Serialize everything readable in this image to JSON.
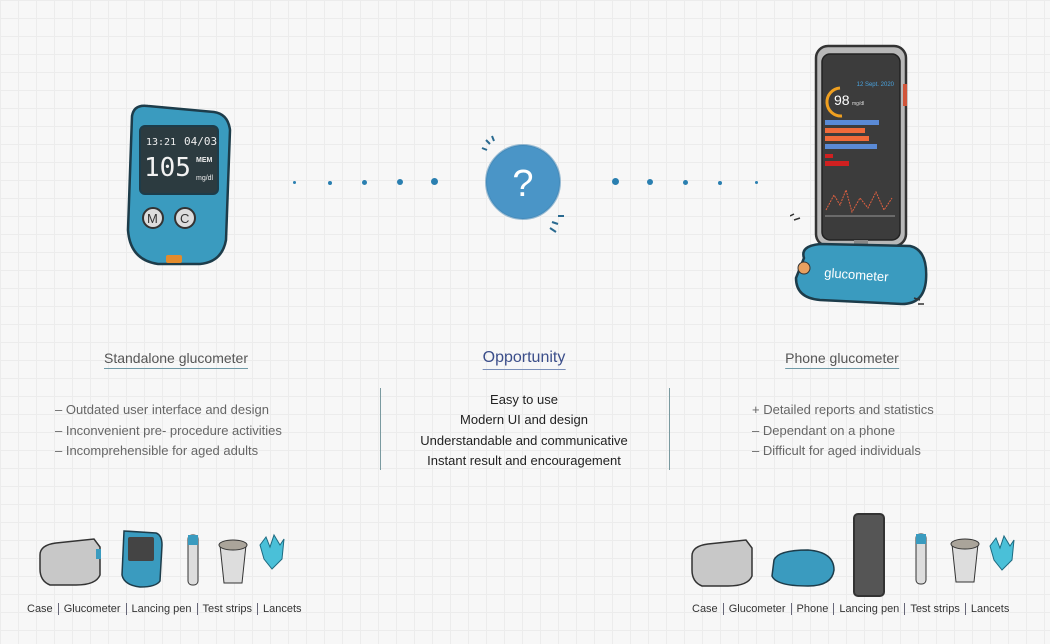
{
  "standalone": {
    "heading": "Standalone glucometer",
    "points": [
      "– Outdated user interface and design",
      "– Inconvenient pre- procedure activities",
      "– Incomprehensible for aged adults"
    ],
    "device_screen": {
      "time": "13:21",
      "date": "04/03",
      "reading": "105",
      "mem": "MEM",
      "unit": "mg/dl",
      "buttons": [
        "M",
        "C"
      ]
    },
    "kit_labels": [
      "Case",
      "Glucometer",
      "Lancing pen",
      "Test strips",
      "Lancets"
    ]
  },
  "opportunity": {
    "heading": "Opportunity",
    "icon": "question-mark-icon",
    "points": [
      "Easy to use",
      "Modern UI and design",
      "Understandable and communicative",
      "Instant result and encouragement"
    ]
  },
  "phone": {
    "heading": "Phone glucometer",
    "points": [
      "+ Detailed reports and statistics",
      "– Dependant on a phone",
      "– Difficult for aged individuals"
    ],
    "device_screen": {
      "date": "12 Sept. 2020",
      "reading": "98",
      "unit": "mg/dl"
    },
    "dongle_label": "glucometer",
    "kit_labels": [
      "Case",
      "Glucometer",
      "Phone",
      "Lancing pen",
      "Test strips",
      "Lancets"
    ]
  },
  "colors": {
    "accent_blue": "#3a9bbf",
    "heading_blue": "#3b4e8a",
    "dots": "#2a7fb0"
  }
}
